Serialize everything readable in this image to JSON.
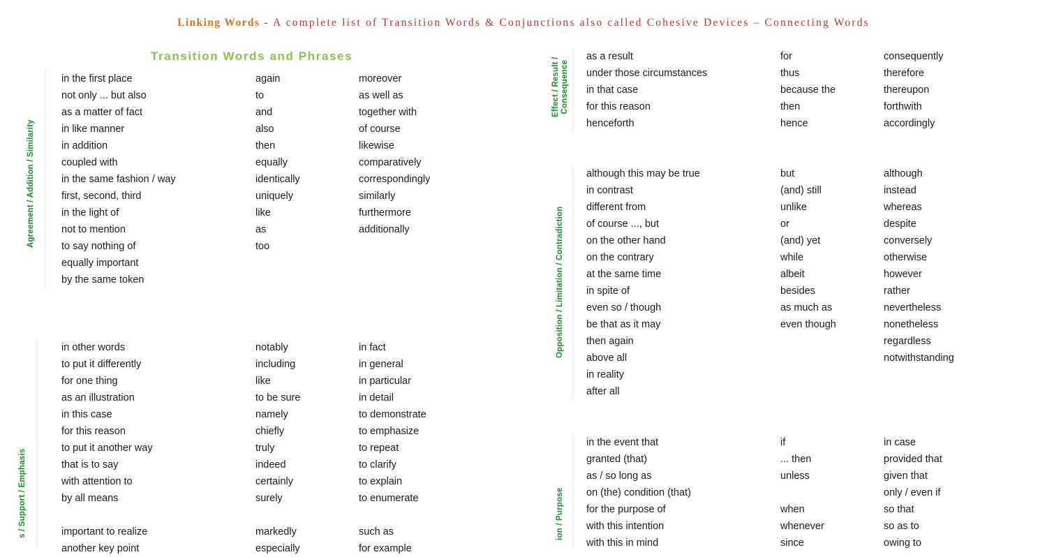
{
  "title": {
    "strong": "Linking Words",
    "rest": " - A complete list of Transition Words & Conjunctions also called Cohesive Devices – Connecting Words"
  },
  "section_heading": "Transition Words and Phrases",
  "blocks": [
    {
      "id": "agreement",
      "label": "Agreement / Addition / Similarity",
      "rows": [
        [
          "in the first place",
          "again",
          "moreover"
        ],
        [
          "not only ... but also",
          "to",
          "as well as"
        ],
        [
          "as a matter of fact",
          "and",
          "together with"
        ],
        [
          "in like manner",
          "also",
          "of course"
        ],
        [
          "in addition",
          "then",
          "likewise"
        ],
        [
          "coupled with",
          "equally",
          "comparatively"
        ],
        [
          "in the same fashion / way",
          "identically",
          "correspondingly"
        ],
        [
          "first, second, third",
          "uniquely",
          "similarly"
        ],
        [
          "in the light of",
          "like",
          "furthermore"
        ],
        [
          "not to mention",
          "as",
          "additionally"
        ],
        [
          "to say nothing of",
          "too",
          ""
        ],
        [
          "equally important",
          "",
          ""
        ],
        [
          "by the same token",
          "",
          ""
        ]
      ]
    },
    {
      "id": "examples",
      "label": "s / Support / Emphasis",
      "rows": [
        [
          "in other words",
          "notably",
          "in fact"
        ],
        [
          "to put it differently",
          "including",
          "in general"
        ],
        [
          "for one thing",
          "like",
          "in particular"
        ],
        [
          "as an illustration",
          "to be sure",
          "in detail"
        ],
        [
          "in this case",
          "namely",
          "to demonstrate"
        ],
        [
          "for this reason",
          "chiefly",
          "to emphasize"
        ],
        [
          "to put it another way",
          "truly",
          "to repeat"
        ],
        [
          "that is to say",
          "indeed",
          "to clarify"
        ],
        [
          "with attention to",
          "certainly",
          "to explain"
        ],
        [
          "by all means",
          "surely",
          "to enumerate"
        ],
        [
          "",
          "",
          ""
        ],
        [
          "important to realize",
          "markedly",
          "such as"
        ],
        [
          "another key point",
          "especially",
          "for example"
        ]
      ]
    },
    {
      "id": "effect",
      "label_line1": "Effect / Result /",
      "label_line2": "Consequence",
      "rows": [
        [
          "as a result",
          "for",
          "consequently"
        ],
        [
          "under those circumstances",
          "thus",
          "therefore"
        ],
        [
          "in that case",
          "because the",
          "thereupon"
        ],
        [
          "for this reason",
          "then",
          "forthwith"
        ],
        [
          "henceforth",
          "hence",
          "accordingly"
        ]
      ]
    },
    {
      "id": "opposition",
      "label": "Opposition / Limitation / Contradiction",
      "rows": [
        [
          "although this may be true",
          "but",
          "although"
        ],
        [
          "in contrast",
          "(and) still",
          "instead"
        ],
        [
          "different from",
          "unlike",
          "whereas"
        ],
        [
          "of course ..., but",
          "or",
          "despite"
        ],
        [
          "on the other hand",
          "(and) yet",
          "conversely"
        ],
        [
          "on the contrary",
          "while",
          "otherwise"
        ],
        [
          "at the same time",
          "albeit",
          "however"
        ],
        [
          "in spite of",
          "besides",
          "rather"
        ],
        [
          "even so / though",
          "as much as",
          "nevertheless"
        ],
        [
          "be that as it may",
          "even though",
          "nonetheless"
        ],
        [
          "then again",
          "",
          "regardless"
        ],
        [
          "above all",
          "",
          "notwithstanding"
        ],
        [
          "in reality",
          "",
          ""
        ],
        [
          "after all",
          "",
          ""
        ]
      ]
    },
    {
      "id": "condition",
      "label": "ion / Purpose",
      "rows": [
        [
          "in the event that",
          "if",
          "in case"
        ],
        [
          "granted (that)",
          "... then",
          "provided that"
        ],
        [
          "as / so long as",
          "unless",
          "given that"
        ],
        [
          "on (the) condition (that)",
          "",
          "only / even if"
        ],
        [
          "for the purpose of",
          "when",
          "so that"
        ],
        [
          "with this intention",
          "whenever",
          "so as to"
        ],
        [
          "with this in mind",
          "since",
          "owing to"
        ]
      ]
    }
  ],
  "colors": {
    "title_strong": "#cc7722",
    "title_rest": "#b03a3a",
    "heading_green": "#8bc34a",
    "label_green": "#1f8a2e",
    "body_text": "#1a1a1a"
  }
}
